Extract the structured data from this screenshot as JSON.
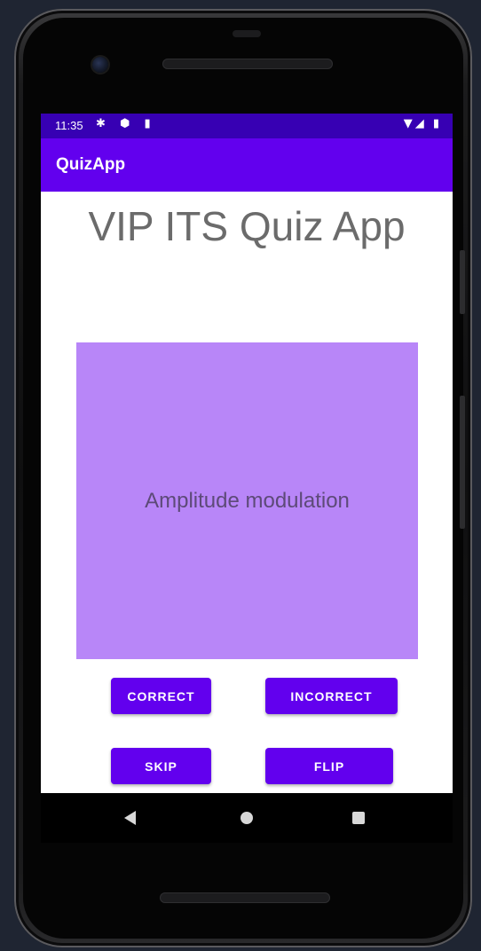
{
  "status_bar": {
    "time": "11:35",
    "left_icons": "✱ ⬢ ▮",
    "right_icons": "▼◢ ▮"
  },
  "app_bar": {
    "title": "QuizApp"
  },
  "main": {
    "title": "VIP ITS Quiz App",
    "card_text": "Amplitude modulation",
    "buttons": {
      "correct": "CORRECT",
      "incorrect": "INCORRECT",
      "skip": "SKIP",
      "flip": "FLIP"
    }
  },
  "nav_bar": {
    "icons": [
      "back-icon",
      "home-icon",
      "recents-icon"
    ]
  },
  "colors": {
    "status_bar": "#3700b3",
    "app_bar": "#6200ee",
    "button": "#6200ee",
    "card": "#b886f8",
    "title_text": "#6b6b6b"
  }
}
